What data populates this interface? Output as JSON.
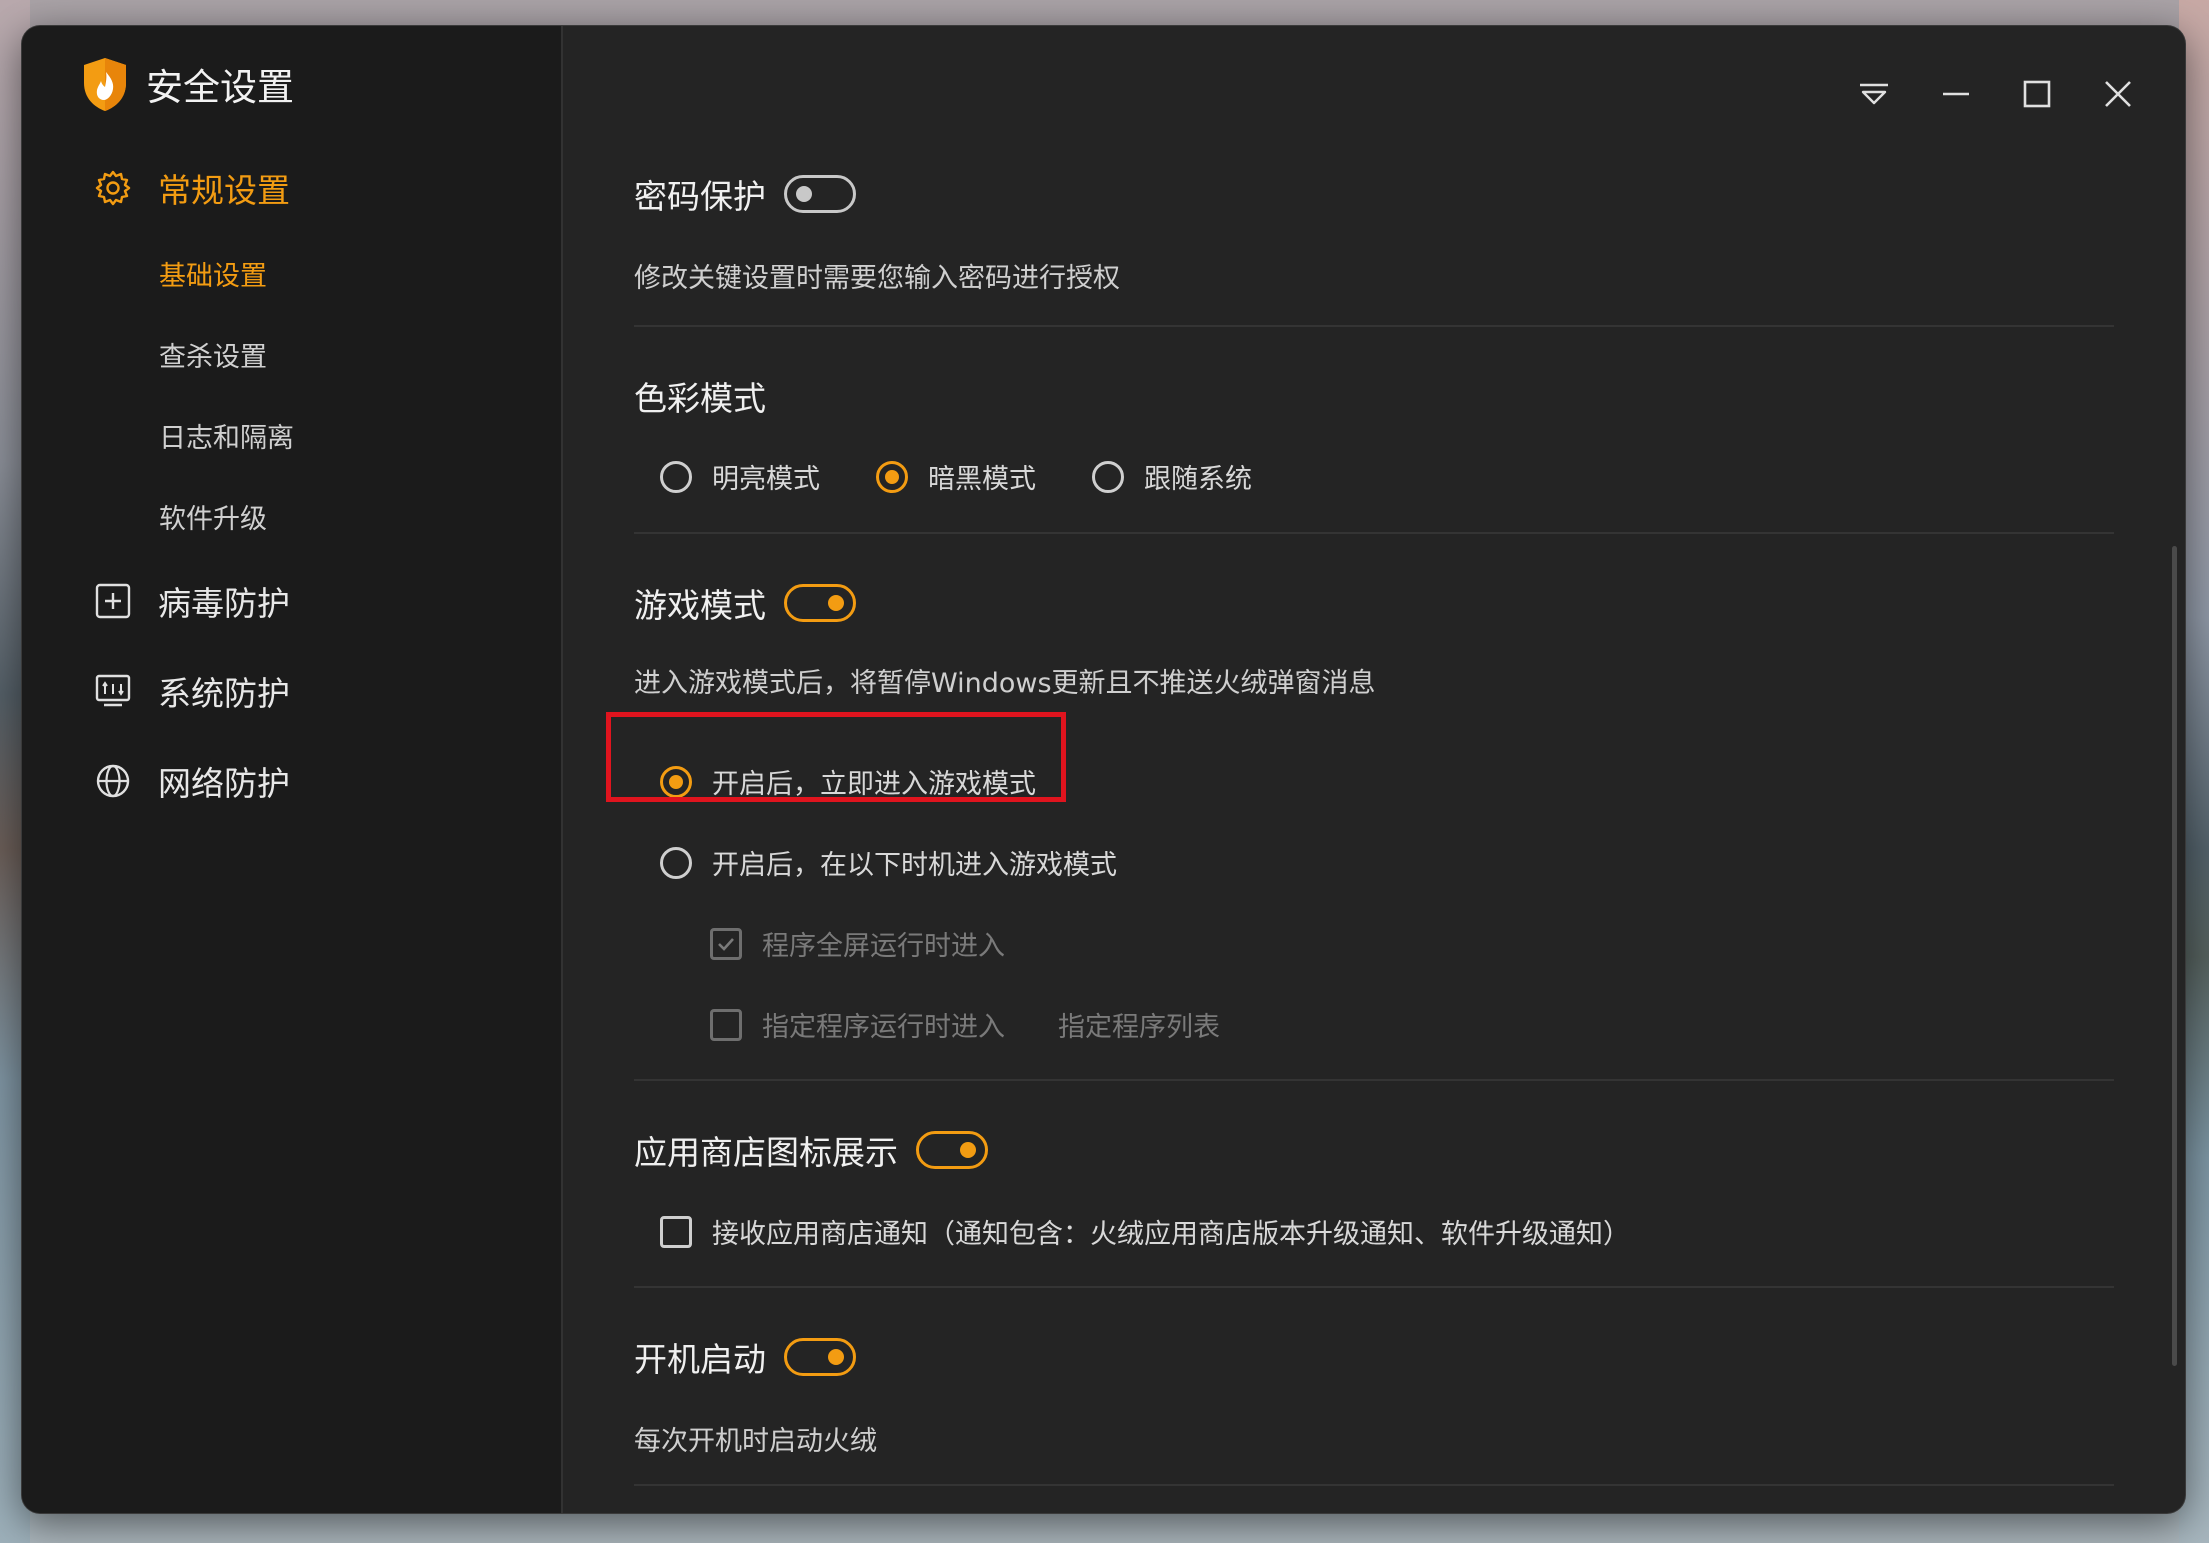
{
  "app": {
    "title": "安全设置",
    "logo": "flame-shield-icon"
  },
  "window_controls": [
    "menu-icon",
    "minimize-icon",
    "maximize-icon",
    "close-icon"
  ],
  "sidebar": {
    "general": {
      "label": "常规设置",
      "icon": "gear-icon"
    },
    "sub_items": [
      {
        "label": "基础设置",
        "active": true
      },
      {
        "label": "查杀设置",
        "active": false
      },
      {
        "label": "日志和隔离",
        "active": false
      },
      {
        "label": "软件升级",
        "active": false
      }
    ],
    "virus": {
      "label": "病毒防护",
      "icon": "plus-box-icon"
    },
    "system": {
      "label": "系统防护",
      "icon": "system-monitor-icon"
    },
    "network": {
      "label": "网络防护",
      "icon": "globe-icon"
    }
  },
  "settings": {
    "password": {
      "title": "密码保护",
      "enabled": false,
      "desc": "修改关键设置时需要您输入密码进行授权"
    },
    "color_mode": {
      "title": "色彩模式",
      "options": [
        "明亮模式",
        "暗黑模式",
        "跟随系统"
      ],
      "selected": "暗黑模式"
    },
    "game_mode": {
      "title": "游戏模式",
      "enabled": true,
      "desc": "进入游戏模式后，将暂停Windows更新且不推送火绒弹窗消息",
      "option_immediate": "开启后，立即进入游戏模式",
      "option_conditional": "开启后，在以下时机进入游戏模式",
      "selected": "开启后，立即进入游戏模式",
      "cond_fullscreen": {
        "label": "程序全屏运行时进入",
        "checked": true
      },
      "cond_program": {
        "label": "指定程序运行时进入",
        "checked": false
      },
      "program_list_link": "指定程序列表"
    },
    "app_store": {
      "title": "应用商店图标展示",
      "enabled": true,
      "notify_label": "接收应用商店通知（通知包含：火绒应用商店版本升级通知、软件升级通知）",
      "notify_checked": false
    },
    "startup": {
      "title": "开机启动",
      "enabled": true,
      "desc": "每次开机时启动火绒"
    }
  },
  "colors": {
    "accent": "#f39c12",
    "highlight": "#e0141e",
    "window_bg": "#242424",
    "sidebar_bg": "#1b1b1b"
  }
}
